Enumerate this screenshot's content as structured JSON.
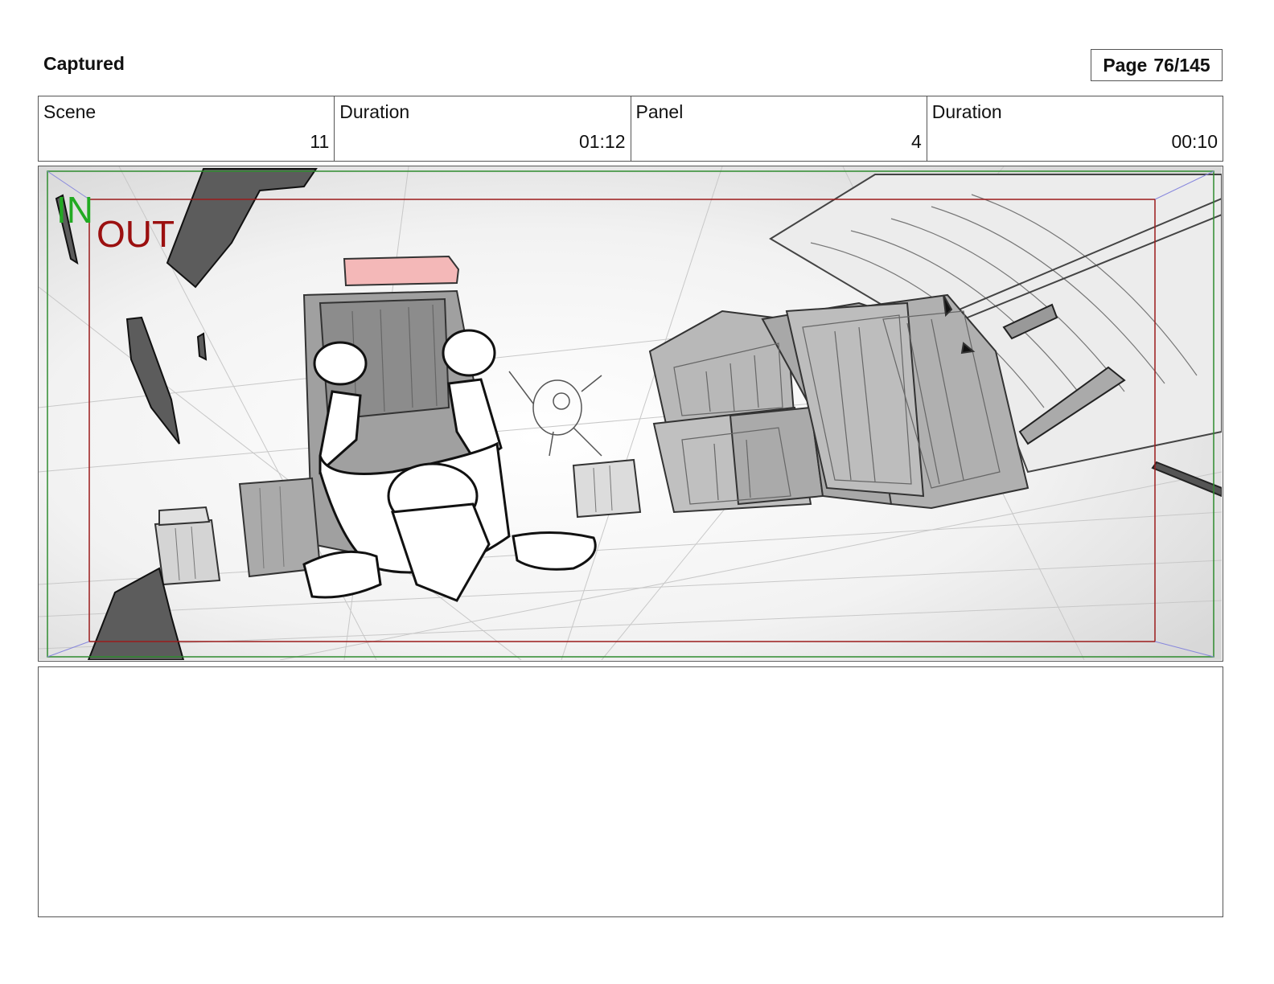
{
  "header": {
    "title": "Captured",
    "page_label": "Page",
    "page_value": "76/145"
  },
  "meta": [
    {
      "label": "Scene",
      "value": "11"
    },
    {
      "label": "Duration",
      "value": "01:12"
    },
    {
      "label": "Panel",
      "value": "4"
    },
    {
      "label": "Duration",
      "value": "00:10"
    }
  ],
  "panel": {
    "in_label": "IN",
    "out_label": "OUT"
  },
  "colors": {
    "in_frame": "#2e8b2e",
    "out_frame": "#9b1b1b",
    "label_in": "#22aa22",
    "label_out": "#9b1010"
  },
  "notes": {
    "text": ""
  }
}
